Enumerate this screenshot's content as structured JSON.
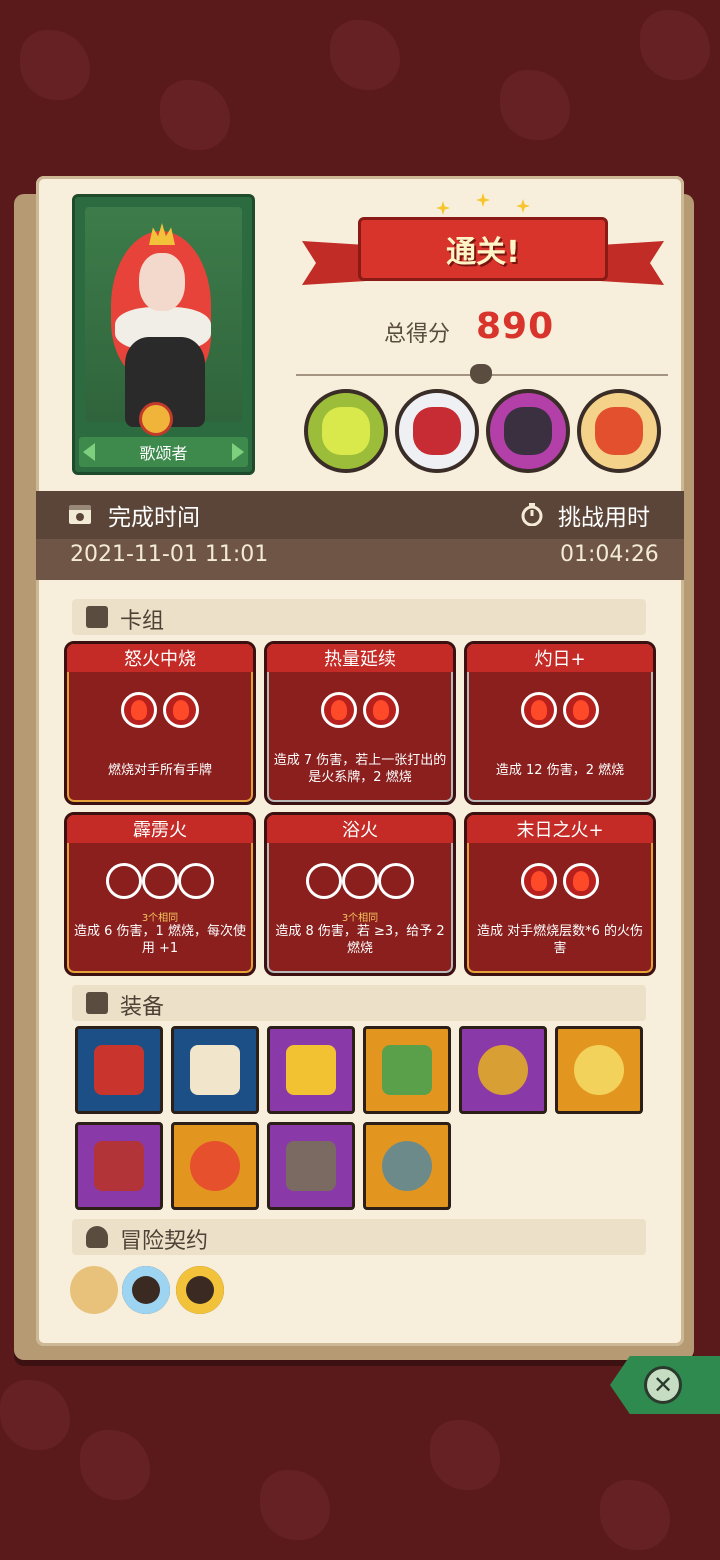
{
  "character": {
    "name": "歌颂者"
  },
  "result": {
    "title": "通关!",
    "score_label": "总得分",
    "score": "890"
  },
  "bosses": [
    {
      "icon": "skeleton-dragon-boss-icon"
    },
    {
      "icon": "drum-robot-boss-icon"
    },
    {
      "icon": "dark-beast-boss-icon"
    },
    {
      "icon": "lion-dance-boss-icon"
    }
  ],
  "times": {
    "finish_label": "完成时间",
    "finish_value": "2021-11-01 11:01",
    "duration_label": "挑战用时",
    "duration_value": "01:04:26"
  },
  "sections": {
    "deck": "卡组",
    "equipment": "装备",
    "contract": "冒险契约"
  },
  "cards": [
    {
      "title": "怒火中烧",
      "orbs": "2",
      "desc": "燃烧对手所有手牌",
      "sub": ""
    },
    {
      "title": "热量延续",
      "orbs": "2",
      "desc": "造成 7 伤害，若上一张打出的是火系牌，2 燃烧",
      "sub": ""
    },
    {
      "title": "灼日+",
      "orbs": "2",
      "desc": "造成 12 伤害，2 燃烧",
      "sub": ""
    },
    {
      "title": "霹雳火",
      "orbs": "3-empty",
      "desc": "造成 6 伤害，1 燃烧，每次使用 +1",
      "sub": "3个相同"
    },
    {
      "title": "浴火",
      "orbs": "3-empty",
      "desc": "造成 8 伤害，若 ≥3，给予 2 燃烧",
      "sub": "3个相同"
    },
    {
      "title": "末日之火+",
      "orbs": "2",
      "desc": "造成 对手燃烧层数*6 的火伤害",
      "sub": ""
    }
  ],
  "equipment": [
    {
      "rarity": "blue",
      "icon": "red-book-icon"
    },
    {
      "rarity": "blue",
      "icon": "scroll-icon"
    },
    {
      "rarity": "purple",
      "icon": "flame-gem-icon"
    },
    {
      "rarity": "orange",
      "icon": "green-slab-icon"
    },
    {
      "rarity": "purple",
      "icon": "ruby-ring-icon"
    },
    {
      "rarity": "orange",
      "icon": "lion-ring-icon"
    },
    {
      "rarity": "purple",
      "icon": "emerald-bracer-icon"
    },
    {
      "rarity": "orange",
      "icon": "fire-skull-icon"
    },
    {
      "rarity": "purple",
      "icon": "ember-stone-icon"
    },
    {
      "rarity": "orange",
      "icon": "rune-disc-icon"
    }
  ],
  "contracts": [
    {
      "icon": "contract-scroll-icon"
    },
    {
      "icon": "blue-firecracker-icon"
    },
    {
      "icon": "gold-firecracker-icon"
    }
  ],
  "colors": {
    "accent": "#d8342c",
    "panel": "#f7efdc",
    "band": "#6e5546"
  }
}
